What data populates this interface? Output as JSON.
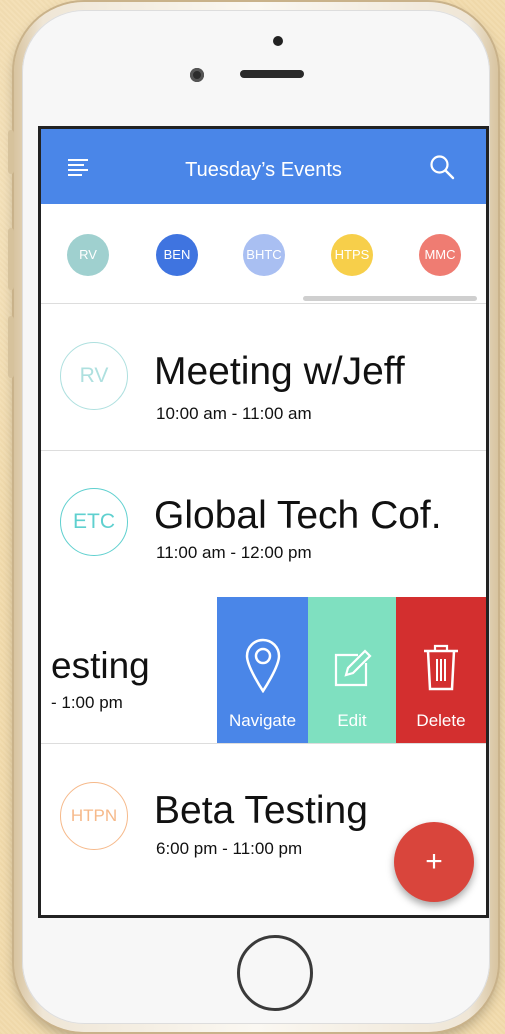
{
  "header": {
    "title": "Tuesday’s Events"
  },
  "chips": [
    {
      "label": "RV",
      "color": "#9fd0cf"
    },
    {
      "label": "BEN",
      "color": "#3f74e0"
    },
    {
      "label": "BHTC",
      "color": "#a9bff2"
    },
    {
      "label": "HTPS",
      "color": "#f7cf4a"
    },
    {
      "label": "MMC",
      "color": "#ef7c72"
    }
  ],
  "events": [
    {
      "avatar": "RV",
      "title": "Meeting w/Jeff",
      "time": "10:00 am - 11:00 am",
      "color": "#aee0df"
    },
    {
      "avatar": "ETC",
      "title": "Global Tech Cof.",
      "time": "11:00 am - 12:00 pm",
      "color": "#5fd0cf"
    }
  ],
  "swiped_event": {
    "title_fragment": "esting",
    "time_fragment": "- 1:00 pm"
  },
  "swipe_actions": [
    {
      "label": "Navigate",
      "icon": "map-pin-icon",
      "color": "#4a86e8"
    },
    {
      "label": "Edit",
      "icon": "edit-icon",
      "color": "#7fe0c0"
    },
    {
      "label": "Delete",
      "icon": "trash-icon",
      "color": "#d32f2f"
    }
  ],
  "last_event": {
    "avatar": "HTPN",
    "title": "Beta Testing",
    "time": "6:00 pm - 11:00 pm",
    "color": "#f6b98a"
  },
  "fab": {
    "label": "+"
  }
}
